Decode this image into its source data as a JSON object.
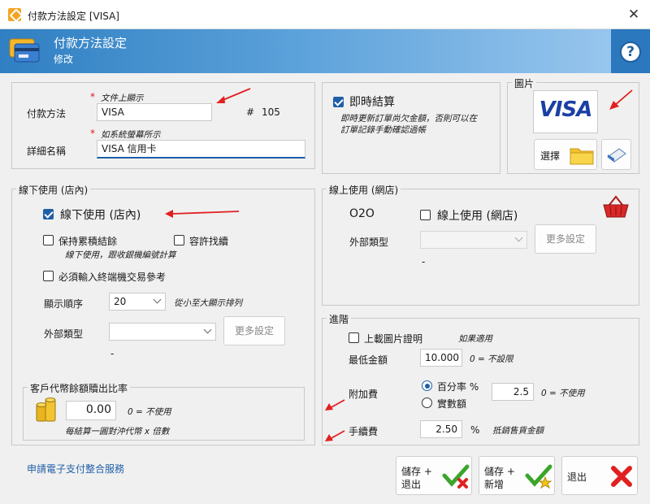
{
  "window": {
    "title": "付款方法設定 [VISA]"
  },
  "header": {
    "title": "付款方法設定",
    "subtitle": "修改"
  },
  "basic": {
    "payment_method_label": "付款方法",
    "payment_method_note": "文件上顯示",
    "payment_method_value": "VISA",
    "id_hash": "#",
    "id_value": "105",
    "detail_label": "詳細名稱",
    "detail_note": "如系統螢幕所示",
    "detail_value": "VISA 信用卡"
  },
  "instant": {
    "label": "即時結算",
    "checked": true,
    "note_line1": "即時更新訂單尚欠金額，否則可以在",
    "note_line2": "訂單記錄手動確認過帳"
  },
  "image": {
    "title": "圖片",
    "visa_text": "VISA",
    "select_label": "選擇"
  },
  "offline": {
    "title": "線下使用 (店內)",
    "enable_label": "線下使用 (店內)",
    "keep_balance_label": "保持累積結餘",
    "keep_balance_note": "線下使用，跟收銀機編號計算",
    "allow_change_label": "容許找續",
    "require_ref_label": "必須輸入終端機交易參考",
    "order_label": "顯示順序",
    "order_value": "20",
    "order_note": "從小至大顯示排列",
    "ext_type_label": "外部類型",
    "ext_type_value": "",
    "more_settings": "更多設定",
    "dash": "-"
  },
  "coin": {
    "title": "客戶代幣餘額贖出比率",
    "value": "0.00",
    "note": "0 = 不使用",
    "sub_note": "每結算一圓對沖代幣 x 倍數"
  },
  "online": {
    "title": "線上使用 (網店)",
    "o2o": "O2O",
    "enable_label": "線上使用 (網店)",
    "ext_type_label": "外部類型",
    "ext_type_value": "",
    "more_settings": "更多設定",
    "dash": "-"
  },
  "advanced": {
    "title": "進階",
    "upload_label": "上載圖片證明",
    "upload_note": "如果適用",
    "min_amount_label": "最低金額",
    "min_amount_value": "10.000",
    "min_amount_note": "0 = 不設限",
    "surcharge_label": "附加費",
    "percent_label": "百分率 %",
    "actual_label": "實數額",
    "surcharge_value": "2.5",
    "surcharge_note": "0 = 不使用",
    "fee_label": "手續費",
    "fee_value": "2.50",
    "fee_unit": "%",
    "fee_note": "抵銷售貨金額"
  },
  "footer": {
    "apply_link": "申請電子支付整合服務",
    "save_exit_line1": "儲存 +",
    "save_exit_line2": "退出",
    "save_new_line1": "儲存 +",
    "save_new_line2": "新增",
    "exit_label": "退出"
  },
  "colors": {
    "accent": "#1f5fa8",
    "banner": "#4a93d3",
    "annotation_red": "#e02020",
    "visa_blue": "#1a3fa5"
  }
}
